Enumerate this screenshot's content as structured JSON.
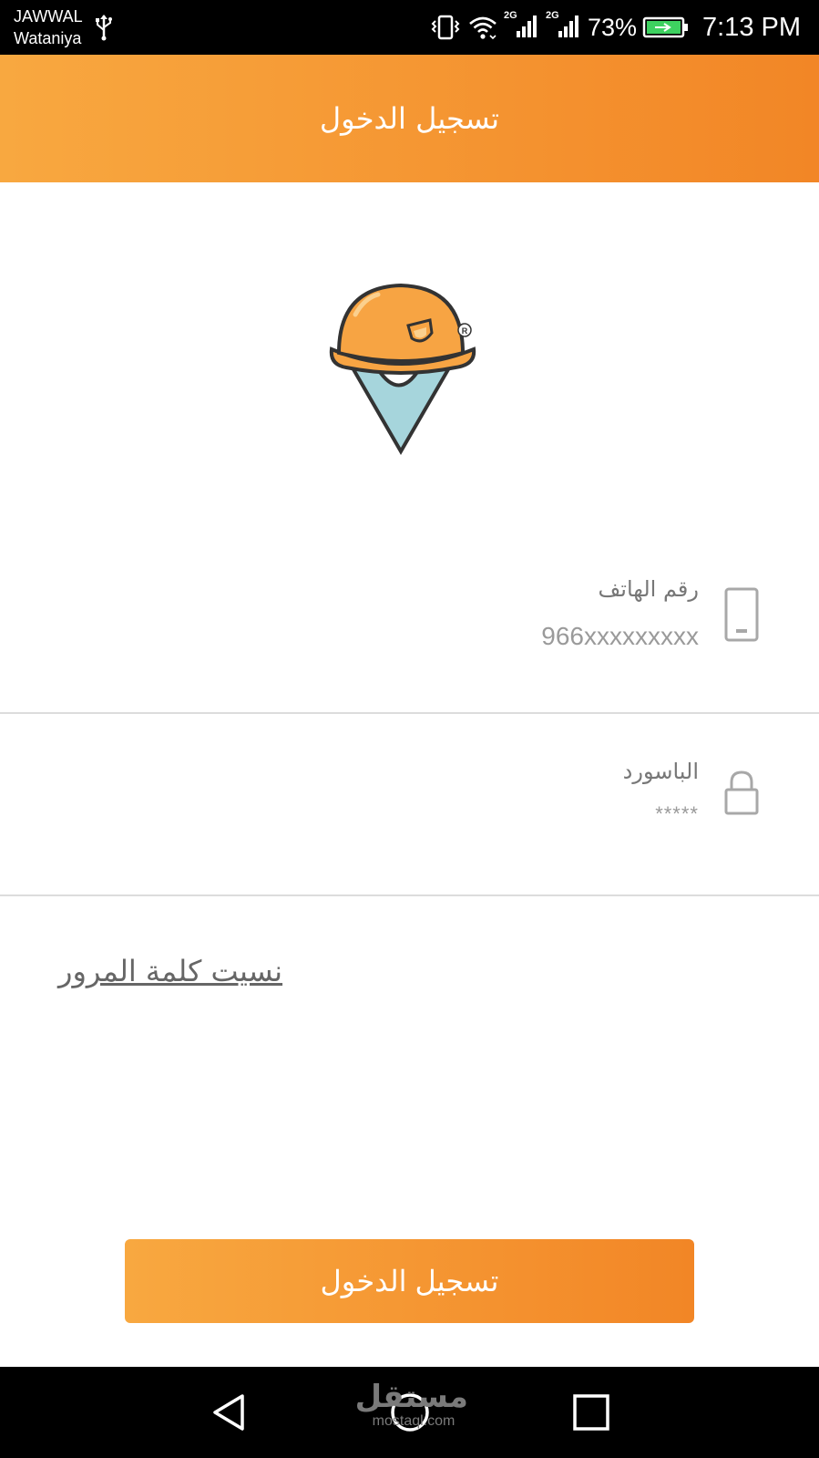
{
  "status_bar": {
    "carrier_1": "JAWWAL",
    "carrier_2": "Wataniya",
    "battery_percent": "73%",
    "time": "7:13 PM",
    "network_1": "2G",
    "network_2": "2G",
    "icons": [
      "usb-icon",
      "vibrate-icon",
      "wifi-icon",
      "signal-icon",
      "signal-icon",
      "battery-charging-icon"
    ]
  },
  "toolbar": {
    "title": "تسجيل الدخول"
  },
  "logo": {
    "icon": "hard-hat-location-pin-logo"
  },
  "form": {
    "phone": {
      "label": "رقم الهاتف",
      "placeholder": "966xxxxxxxxx",
      "icon": "phone-icon"
    },
    "password": {
      "label": "الباسورد",
      "placeholder": "*****",
      "icon": "lock-icon"
    }
  },
  "forgot_password": "نسيت كلمة المرور",
  "login_button": "تسجيل الدخول",
  "nav_bar": {
    "icons": [
      "back-icon",
      "home-icon",
      "recent-apps-icon"
    ]
  },
  "watermark": {
    "arabic": "مستقل",
    "latin": "mostaql.com"
  },
  "colors": {
    "accent_start": "#f8a840",
    "accent_end": "#f28626"
  }
}
